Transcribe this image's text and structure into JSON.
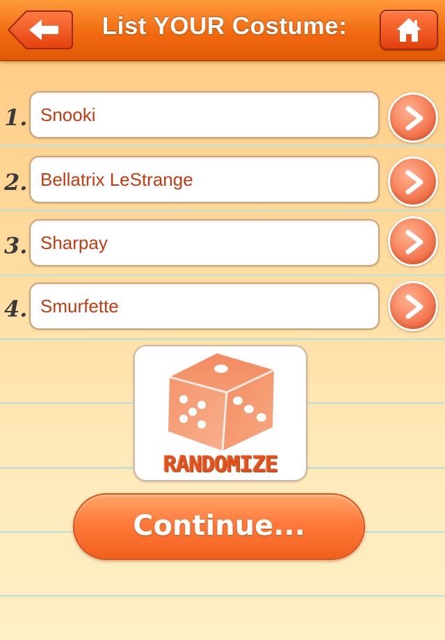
{
  "header": {
    "title": "List YOUR Costume:",
    "back_icon": "back-arrow-icon",
    "home_icon": "home-icon"
  },
  "costumes": [
    {
      "number": "1.",
      "value": "Snooki"
    },
    {
      "number": "2.",
      "value": "Bellatrix LeStrange"
    },
    {
      "number": "3.",
      "value": "Sharpay"
    },
    {
      "number": "4.",
      "value": "Smurfette"
    }
  ],
  "randomize": {
    "label": "RANDOMIZE",
    "icon": "dice-icon"
  },
  "continue": {
    "label": "Continue..."
  },
  "colors": {
    "header": "#f26a10",
    "accent": "#ff7a3a",
    "input_text": "#c43a10",
    "ruled_line": "#bfe0d2"
  }
}
